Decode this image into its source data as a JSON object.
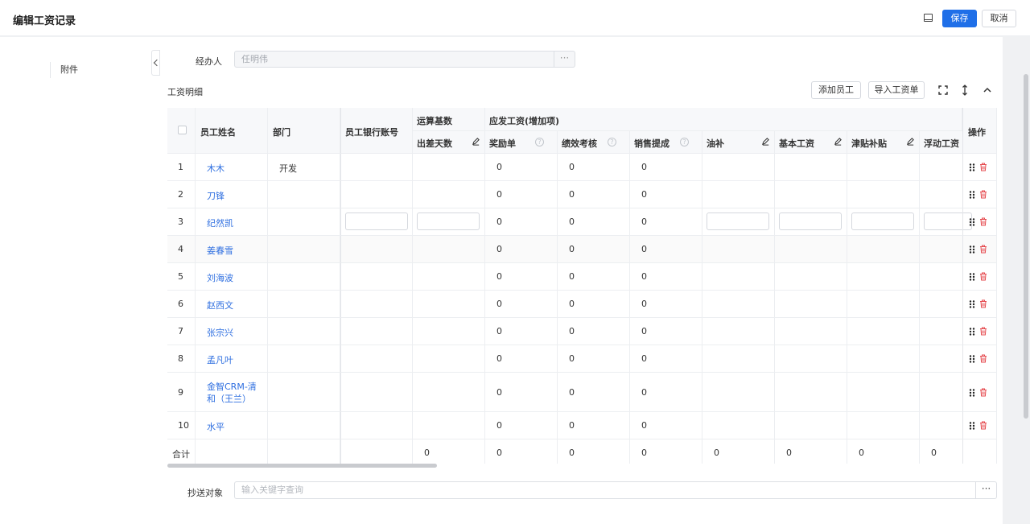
{
  "header": {
    "title": "编辑工资记录",
    "save_label": "保存",
    "cancel_label": "取消"
  },
  "sidebar": {
    "items": [
      {
        "label": "附件"
      }
    ]
  },
  "form": {
    "handler_label": "经办人",
    "handler_value": "任明伟",
    "section_title": "工资明细",
    "add_employee_label": "添加员工",
    "import_label": "导入工资单",
    "cc_label": "抄送对象",
    "cc_placeholder": "输入关键字查询"
  },
  "table": {
    "headers": {
      "name": "员工姓名",
      "dept": "部门",
      "bank": "员工银行账号",
      "calc_group": "运算基数",
      "pay_group": "应发工资(增加项)",
      "trip_days": "出差天数",
      "bonus": "奖励单",
      "perf": "绩效考核",
      "sales": "销售提成",
      "oil": "油补",
      "base": "基本工资",
      "allowance": "津贴补贴",
      "float": "浮动工资",
      "actions": "操作"
    },
    "rows": [
      {
        "idx": "1",
        "name": "木木",
        "dept": "开发",
        "bonus": "0",
        "perf": "0",
        "sales": "0"
      },
      {
        "idx": "2",
        "name": "刀锋",
        "dept": "",
        "bonus": "0",
        "perf": "0",
        "sales": "0"
      },
      {
        "idx": "3",
        "name": "纪然凯",
        "dept": "",
        "bonus": "0",
        "perf": "0",
        "sales": "0"
      },
      {
        "idx": "4",
        "name": "姜春雪",
        "dept": "",
        "bonus": "0",
        "perf": "0",
        "sales": "0"
      },
      {
        "idx": "5",
        "name": "刘海波",
        "dept": "",
        "bonus": "0",
        "perf": "0",
        "sales": "0"
      },
      {
        "idx": "6",
        "name": "赵西文",
        "dept": "",
        "bonus": "0",
        "perf": "0",
        "sales": "0"
      },
      {
        "idx": "7",
        "name": "张宗兴",
        "dept": "",
        "bonus": "0",
        "perf": "0",
        "sales": "0"
      },
      {
        "idx": "8",
        "name": "孟凡叶",
        "dept": "",
        "bonus": "0",
        "perf": "0",
        "sales": "0"
      },
      {
        "idx": "9",
        "name": "金智CRM-清",
        "name2": "和（王兰）",
        "dept": "",
        "bonus": "0",
        "perf": "0",
        "sales": "0"
      },
      {
        "idx": "10",
        "name": "水平",
        "dept": "",
        "bonus": "0",
        "perf": "0",
        "sales": "0"
      }
    ],
    "total": {
      "label": "合计",
      "trip_days": "0",
      "bonus": "0",
      "perf": "0",
      "sales": "0",
      "oil": "0",
      "base": "0",
      "allowance": "0",
      "float": "0"
    }
  },
  "colors": {
    "primary": "#1f6fe8",
    "link": "#2f6fe0",
    "delete": "#e5484d"
  }
}
